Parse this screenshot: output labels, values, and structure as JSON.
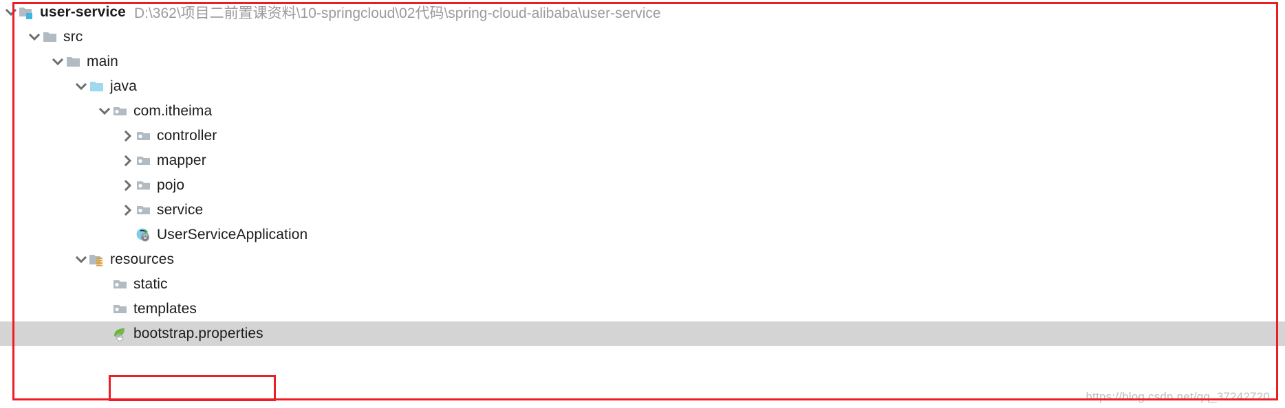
{
  "project": {
    "root_label": "user-service",
    "root_path": "D:\\362\\项目二前置课资料\\10-springcloud\\02代码\\spring-cloud-alibaba\\user-service"
  },
  "tree": {
    "rows": [
      {
        "label": "user-service",
        "indent": 0,
        "toggle": "expanded",
        "icon": "module-folder-icon",
        "bold": true,
        "path": "D:\\362\\项目二前置课资料\\10-springcloud\\02代码\\spring-cloud-alibaba\\user-service",
        "selected": false
      },
      {
        "label": "src",
        "indent": 1,
        "toggle": "expanded",
        "icon": "folder-icon",
        "bold": false,
        "path": "",
        "selected": false
      },
      {
        "label": "main",
        "indent": 2,
        "toggle": "expanded",
        "icon": "folder-icon",
        "bold": false,
        "path": "",
        "selected": false
      },
      {
        "label": "java",
        "indent": 3,
        "toggle": "expanded",
        "icon": "source-root-folder-icon",
        "bold": false,
        "path": "",
        "selected": false
      },
      {
        "label": "com.itheima",
        "indent": 4,
        "toggle": "expanded",
        "icon": "package-icon",
        "bold": false,
        "path": "",
        "selected": false
      },
      {
        "label": "controller",
        "indent": 5,
        "toggle": "collapsed",
        "icon": "package-icon",
        "bold": false,
        "path": "",
        "selected": false
      },
      {
        "label": "mapper",
        "indent": 5,
        "toggle": "collapsed",
        "icon": "package-icon",
        "bold": false,
        "path": "",
        "selected": false
      },
      {
        "label": "pojo",
        "indent": 5,
        "toggle": "collapsed",
        "icon": "package-icon",
        "bold": false,
        "path": "",
        "selected": false
      },
      {
        "label": "service",
        "indent": 5,
        "toggle": "collapsed",
        "icon": "package-icon",
        "bold": false,
        "path": "",
        "selected": false
      },
      {
        "label": "UserServiceApplication",
        "indent": 5,
        "toggle": "none",
        "icon": "spring-boot-run-class-icon",
        "bold": false,
        "path": "",
        "selected": false
      },
      {
        "label": "resources",
        "indent": 3,
        "toggle": "expanded",
        "icon": "resources-root-folder-icon",
        "bold": false,
        "path": "",
        "selected": false
      },
      {
        "label": "static",
        "indent": 4,
        "toggle": "none",
        "icon": "package-icon",
        "bold": false,
        "path": "",
        "selected": false
      },
      {
        "label": "templates",
        "indent": 4,
        "toggle": "none",
        "icon": "package-icon",
        "bold": false,
        "path": "",
        "selected": false
      },
      {
        "label": "bootstrap.properties",
        "indent": 4,
        "toggle": "none",
        "icon": "spring-properties-file-icon",
        "bold": false,
        "path": "",
        "selected": true
      }
    ]
  },
  "annotations": {
    "outer_border_color": "#ee1c25",
    "highlight_box_color": "#ee1c25",
    "selection_color": "#d4d4d4"
  },
  "watermark": {
    "text": "https://blog.csdn.net/qq_37242720"
  }
}
